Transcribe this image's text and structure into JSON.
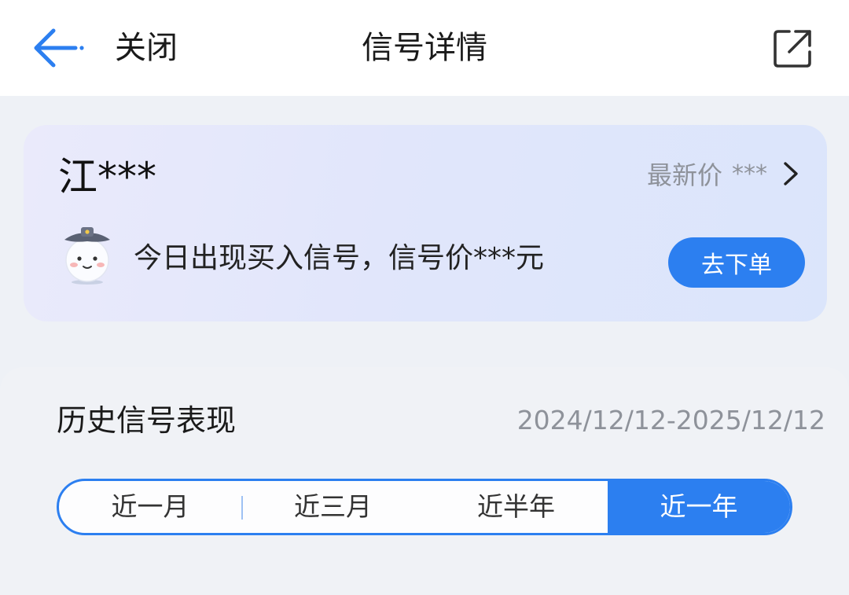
{
  "header": {
    "close_label": "关闭",
    "title": "信号详情"
  },
  "signal_card": {
    "stock_name": "江***",
    "latest_price_label": "最新价",
    "latest_price_value": "***",
    "message": "今日出现买入信号，信号价***元",
    "order_button_label": "去下单"
  },
  "history": {
    "title": "历史信号表现",
    "date_range": "2024/12/12-2025/12/12",
    "tabs": [
      {
        "label": "近一月",
        "active": false
      },
      {
        "label": "近三月",
        "active": false
      },
      {
        "label": "近半年",
        "active": false
      },
      {
        "label": "近一年",
        "active": true
      }
    ]
  },
  "icons": {
    "back": "back-arrow-icon",
    "share": "share-icon",
    "chevron": "chevron-right-icon",
    "mascot": "mascot-icon"
  },
  "colors": {
    "accent": "#2c7ff0",
    "background": "#eef1f6",
    "muted_text": "#8e929a"
  }
}
